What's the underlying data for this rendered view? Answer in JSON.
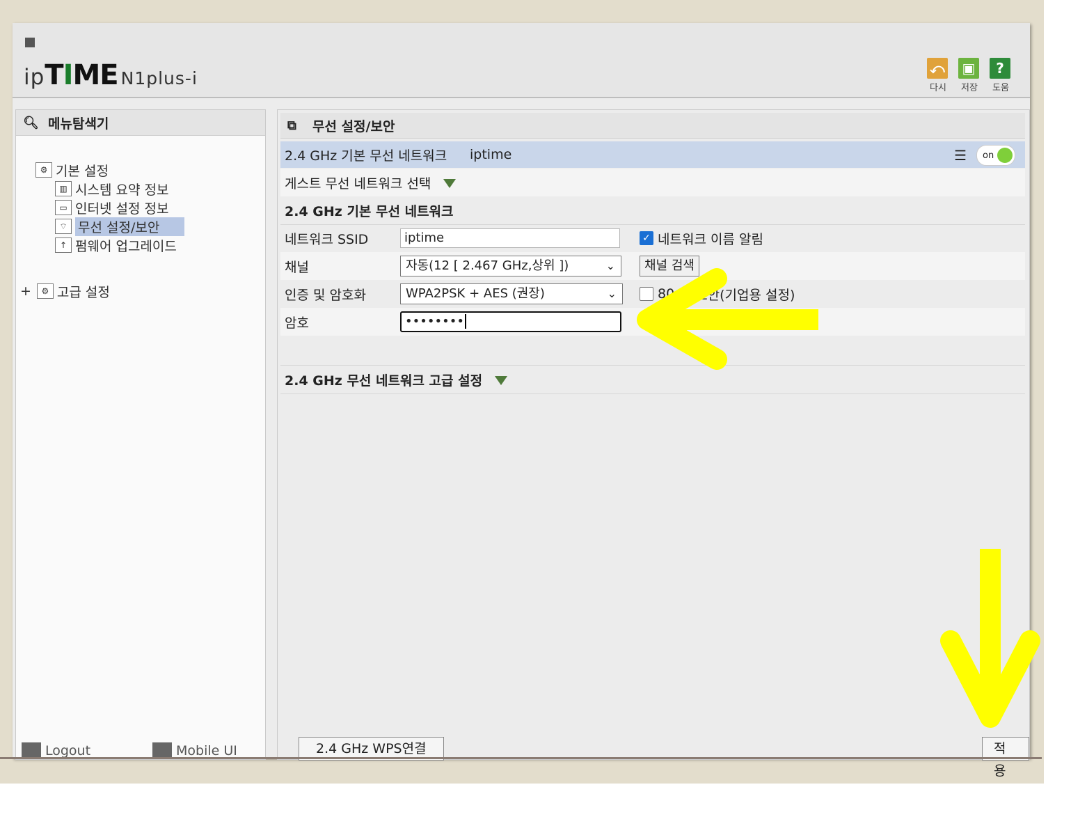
{
  "header": {
    "logo_ip": "ip",
    "logo_time_a": "T",
    "logo_time_b": "I",
    "logo_time_c": "ME",
    "logo_model": "N1plus-i",
    "btn_refresh": "다시",
    "btn_save": "저장",
    "btn_help": "도움"
  },
  "sidebar": {
    "title": "메뉴탐색기",
    "basic": "기본 설정",
    "items": [
      "시스템 요약 정보",
      "인터넷 설정 정보",
      "무선 설정/보안",
      "펌웨어 업그레이드"
    ],
    "advanced": "고급 설정",
    "logout": "Logout",
    "mobile": "Mobile UI"
  },
  "main": {
    "title": "무선 설정/보안",
    "network_bar": "2.4 GHz 기본 무선 네트워크",
    "network_ssid": "iptime",
    "toggle_label": "on",
    "guest": "게스트 무선 네트워크 선택",
    "section": "2.4 GHz 기본 무선 네트워크",
    "ssid_label": "네트워크 SSID",
    "ssid_value": "iptime",
    "broadcast_label": "네트워크 이름 알림",
    "channel_label": "채널",
    "channel_value": "자동(12 [ 2.467 GHz,상위 ])",
    "channel_search": "채널 검색",
    "auth_label": "인증 및 암호화",
    "auth_value": "WPA2PSK + AES (권장)",
    "enterprise_a": "80",
    "enterprise_b": "보안(기업용 설정)",
    "password_label": "암호",
    "password_value": "••••••••",
    "advanced": "2.4 GHz 무선 네트워크 고급 설정",
    "wps": "2.4 GHz WPS연결",
    "apply": "적용"
  },
  "colors": {
    "annotation": "#ffff00",
    "selected": "#b7c7e4",
    "network_bar": "#c9d6ea"
  }
}
